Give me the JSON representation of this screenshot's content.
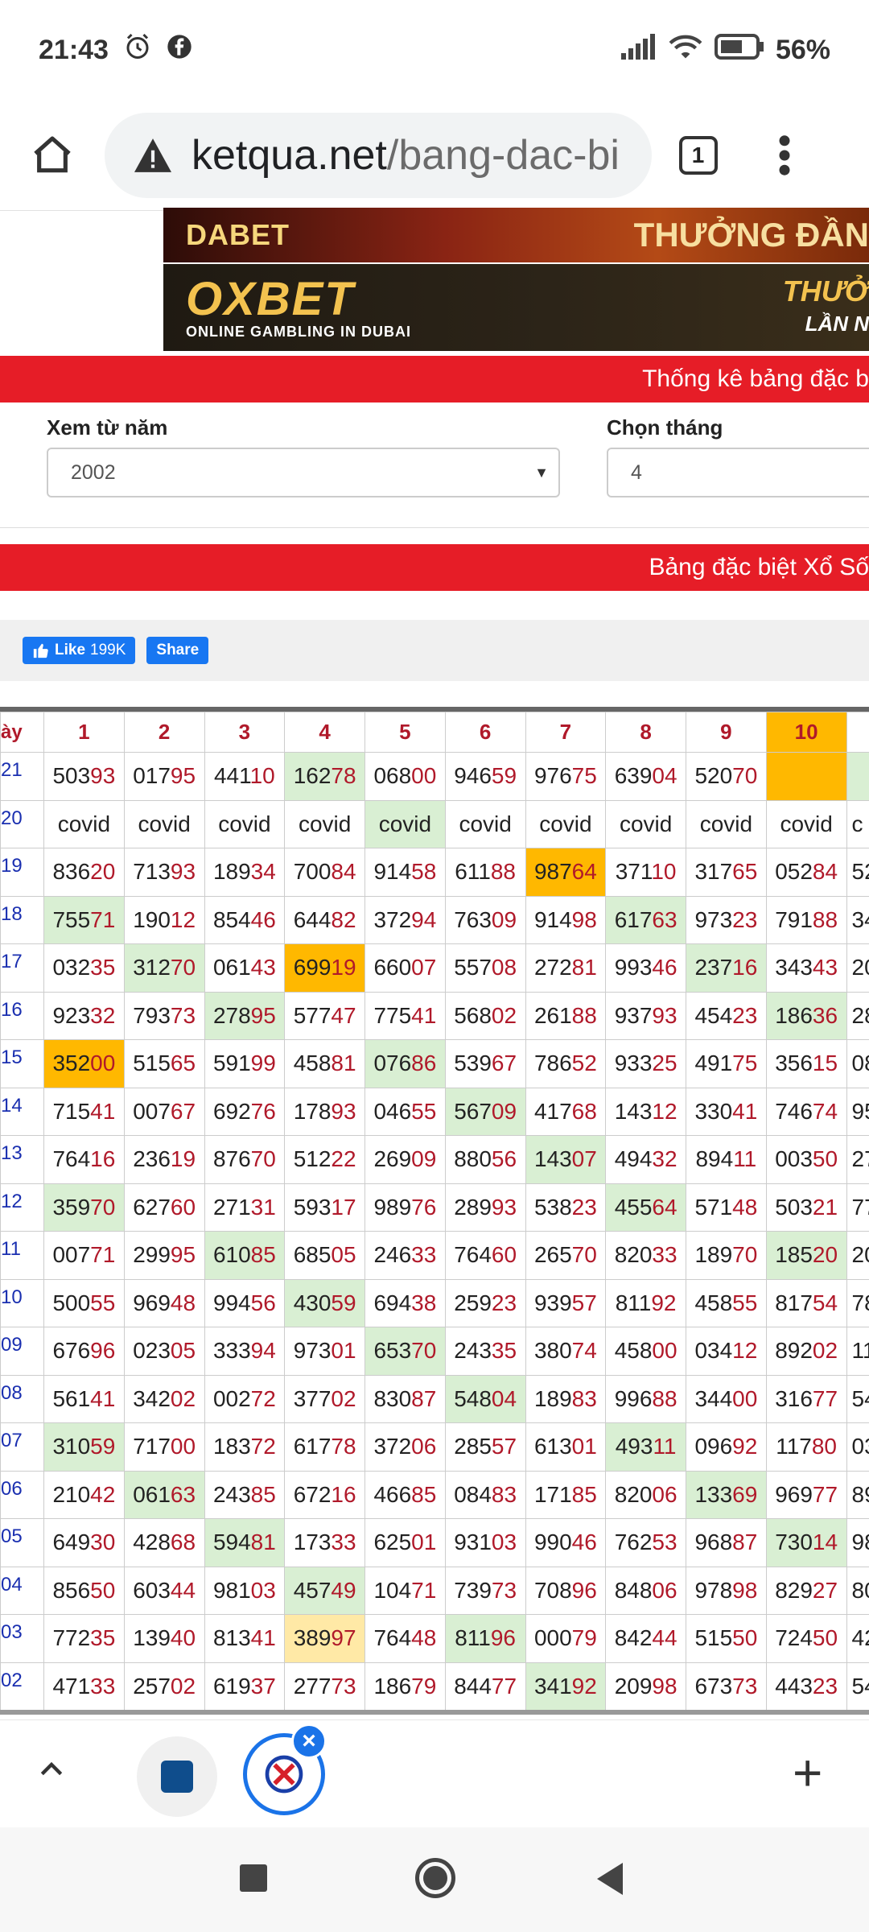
{
  "status": {
    "time": "21:43",
    "battery": "56%"
  },
  "browser": {
    "url_domain": "ketqua.net",
    "url_path": "/bang-dac-bi",
    "tab_count": "1"
  },
  "ads": {
    "banner1_logo": "DABET",
    "banner1_text": "THƯỞNG ĐẦN",
    "banner2_logo": "OXBET",
    "banner2_sub": "ONLINE GAMBLING IN DUBAI",
    "banner2_text1": "THƯỞ",
    "banner2_text2": "LẦN N"
  },
  "section1": {
    "title": "Thống kê bảng đặc b"
  },
  "filters": {
    "year_label": "Xem từ năm",
    "year_value": "2002",
    "month_label": "Chọn tháng",
    "month_value": "4"
  },
  "section2": {
    "title": "Bảng đặc biệt Xổ Số "
  },
  "social": {
    "like_label": "Like",
    "like_count": "199K",
    "share_label": "Share"
  },
  "table": {
    "corner": "ày",
    "columns": [
      "1",
      "2",
      "3",
      "4",
      "5",
      "6",
      "7",
      "8",
      "9",
      "10"
    ],
    "rows": [
      {
        "label": "21",
        "cells": [
          "50393",
          "01795",
          "44110",
          "16278",
          "06800",
          "94659",
          "97675",
          "63904",
          "52070",
          ""
        ]
      },
      {
        "label": "20",
        "cells": [
          "covid",
          "covid",
          "covid",
          "covid",
          "covid",
          "covid",
          "covid",
          "covid",
          "covid",
          "covid"
        ]
      },
      {
        "label": "19",
        "cells": [
          "83620",
          "71393",
          "18934",
          "70084",
          "91458",
          "61188",
          "98764",
          "37110",
          "31765",
          "05284"
        ]
      },
      {
        "label": "18",
        "cells": [
          "75571",
          "19012",
          "85446",
          "64482",
          "37294",
          "76309",
          "91498",
          "61763",
          "97323",
          "79188"
        ]
      },
      {
        "label": "17",
        "cells": [
          "03235",
          "31270",
          "06143",
          "69919",
          "66007",
          "55708",
          "27281",
          "99346",
          "23716",
          "34343"
        ]
      },
      {
        "label": "16",
        "cells": [
          "92332",
          "79373",
          "27895",
          "57747",
          "77541",
          "56802",
          "26188",
          "93793",
          "45423",
          "18636"
        ]
      },
      {
        "label": "15",
        "cells": [
          "35200",
          "51565",
          "59199",
          "45881",
          "07686",
          "53967",
          "78652",
          "93325",
          "49175",
          "35615"
        ]
      },
      {
        "label": "14",
        "cells": [
          "71541",
          "00767",
          "69276",
          "17893",
          "04655",
          "56709",
          "41768",
          "14312",
          "33041",
          "74674"
        ]
      },
      {
        "label": "13",
        "cells": [
          "76416",
          "23619",
          "87670",
          "51222",
          "26909",
          "88056",
          "14307",
          "49432",
          "89411",
          "00350"
        ]
      },
      {
        "label": "12",
        "cells": [
          "35970",
          "62760",
          "27131",
          "59317",
          "98976",
          "28993",
          "53823",
          "45564",
          "57148",
          "50321"
        ]
      },
      {
        "label": "11",
        "cells": [
          "00771",
          "29995",
          "61085",
          "68505",
          "24633",
          "76460",
          "26570",
          "82033",
          "18970",
          "18520"
        ]
      },
      {
        "label": "10",
        "cells": [
          "50055",
          "96948",
          "99456",
          "43059",
          "69438",
          "25923",
          "93957",
          "81192",
          "45855",
          "81754"
        ]
      },
      {
        "label": "09",
        "cells": [
          "67696",
          "02305",
          "33394",
          "97301",
          "65370",
          "24335",
          "38074",
          "45800",
          "03412",
          "89202"
        ]
      },
      {
        "label": "08",
        "cells": [
          "56141",
          "34202",
          "00272",
          "37702",
          "83087",
          "54804",
          "18983",
          "99688",
          "34400",
          "31677"
        ]
      },
      {
        "label": "07",
        "cells": [
          "31059",
          "71700",
          "18372",
          "61778",
          "37206",
          "28557",
          "61301",
          "49311",
          "09692",
          "11780"
        ]
      },
      {
        "label": "06",
        "cells": [
          "21042",
          "06163",
          "24385",
          "67216",
          "46685",
          "08483",
          "17185",
          "82006",
          "13369",
          "96977"
        ]
      },
      {
        "label": "05",
        "cells": [
          "64930",
          "42868",
          "59481",
          "17333",
          "62501",
          "93103",
          "99046",
          "76253",
          "96887",
          "73014"
        ]
      },
      {
        "label": "04",
        "cells": [
          "85650",
          "60344",
          "98103",
          "45749",
          "10471",
          "73973",
          "70896",
          "84806",
          "97898",
          "82927"
        ]
      },
      {
        "label": "03",
        "cells": [
          "77235",
          "13940",
          "81341",
          "38997",
          "76448",
          "81196",
          "00079",
          "84244",
          "51550",
          "72450"
        ]
      },
      {
        "label": "02",
        "cells": [
          "47133",
          "25702",
          "61937",
          "27773",
          "18679",
          "84477",
          "34192",
          "20998",
          "67373",
          "44323"
        ]
      }
    ],
    "partial": [
      "",
      "c",
      "52",
      "34",
      "20",
      "28",
      "08",
      "95",
      "27",
      "77",
      "20",
      "78",
      "11",
      "54",
      "03",
      "89",
      "98",
      "80",
      "42",
      "54"
    ]
  },
  "highlight_colors": {
    "green": "#d9efd3",
    "orange": "#ffb800",
    "yellow": "#ffe9a6"
  }
}
